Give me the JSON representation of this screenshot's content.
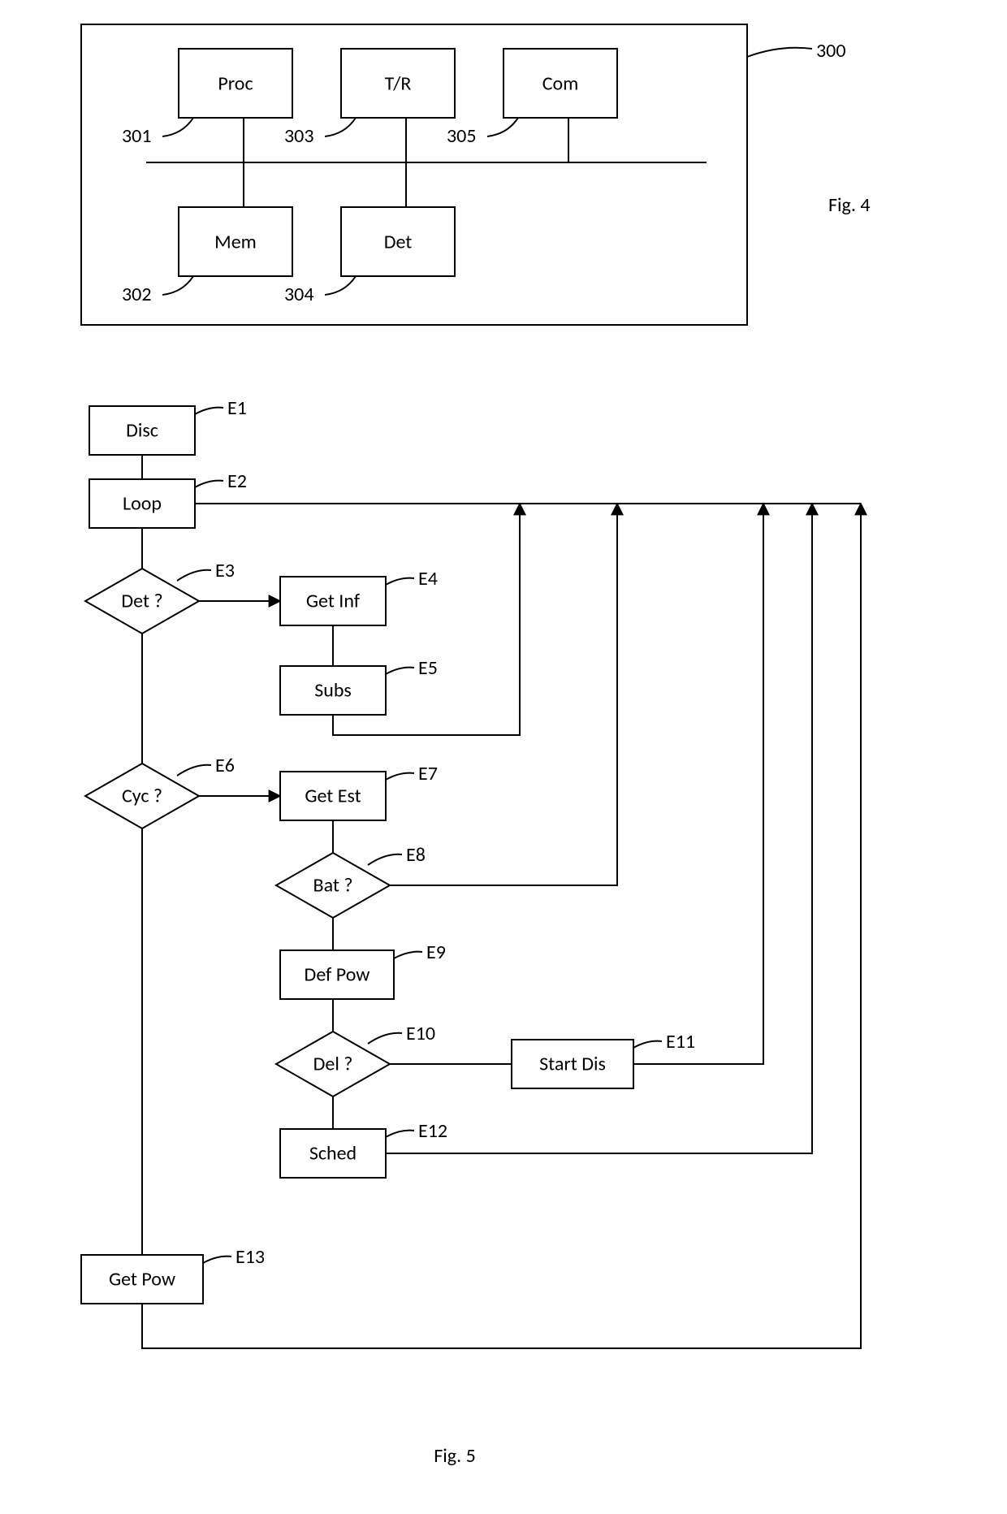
{
  "fig4": {
    "caption": "Fig. 4",
    "container_label": "300",
    "blocks": {
      "proc": {
        "text": "Proc",
        "ref": "301"
      },
      "tr": {
        "text": "T/R",
        "ref": "303"
      },
      "com": {
        "text": "Com",
        "ref": "305"
      },
      "mem": {
        "text": "Mem",
        "ref": "302"
      },
      "det": {
        "text": "Det",
        "ref": "304"
      }
    }
  },
  "fig5": {
    "caption": "Fig. 5",
    "nodes": {
      "disc": {
        "text": "Disc",
        "ref": "E1",
        "shape": "rect"
      },
      "loop": {
        "text": "Loop",
        "ref": "E2",
        "shape": "rect"
      },
      "detq": {
        "text": "Det ?",
        "ref": "E3",
        "shape": "diamond"
      },
      "getinf": {
        "text": "Get Inf",
        "ref": "E4",
        "shape": "rect"
      },
      "subs": {
        "text": "Subs",
        "ref": "E5",
        "shape": "rect"
      },
      "cycq": {
        "text": "Cyc ?",
        "ref": "E6",
        "shape": "diamond"
      },
      "getest": {
        "text": "Get Est",
        "ref": "E7",
        "shape": "rect"
      },
      "batq": {
        "text": "Bat ?",
        "ref": "E8",
        "shape": "diamond"
      },
      "defpow": {
        "text": "Def Pow",
        "ref": "E9",
        "shape": "rect"
      },
      "delq": {
        "text": "Del ?",
        "ref": "E10",
        "shape": "diamond"
      },
      "startdis": {
        "text": "Start Dis",
        "ref": "E11",
        "shape": "rect"
      },
      "sched": {
        "text": "Sched",
        "ref": "E12",
        "shape": "rect"
      },
      "getpow": {
        "text": "Get Pow",
        "ref": "E13",
        "shape": "rect"
      }
    }
  }
}
